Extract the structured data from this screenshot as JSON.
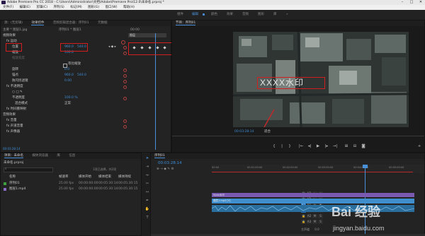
{
  "app": {
    "title_bar": "Adobe Premiere Pro CC 2018 - C:\\Users\\Administrator\\文档\\Adobe\\Premiere Pro\\12.0\\未命名.prproj *",
    "window_buttons": [
      "–",
      "□",
      "✕"
    ]
  },
  "menu": [
    "文件(F)",
    "编辑(E)",
    "剪辑(C)",
    "序列(S)",
    "标记(M)",
    "图形(G)",
    "窗口(W)",
    "帮助(H)"
  ],
  "workspaces": [
    "组件",
    "编辑",
    "颜色",
    "效果",
    "音频",
    "图形",
    "库"
  ],
  "effect_controls": {
    "tabs": [
      "源：(无剪辑)",
      "效果控件",
      "音频剪辑混合器：序列01",
      "元数据"
    ],
    "source_row": "主要 * 图层1.jpg",
    "seq_row": "序列01 * 图层1",
    "timecode_left": "00:00",
    "clip_label": "图层",
    "section_video": "视频效果",
    "motion": "fx 运动",
    "params": [
      {
        "name": "位置",
        "v1": "960.0",
        "v2": "540.0"
      },
      {
        "name": "缩放",
        "v1": "100.0",
        "v2": ""
      },
      {
        "name": "缩放宽度",
        "v1": "",
        "v2": ""
      },
      {
        "name": "",
        "v1": "",
        "v2": ""
      },
      {
        "name": "旋转",
        "v1": "0.0",
        "v2": ""
      },
      {
        "name": "锚点",
        "v1": "960.0",
        "v2": "540.0"
      },
      {
        "name": "防闪烁滤镜",
        "v1": "0.00",
        "v2": ""
      }
    ],
    "uniform_scale": "等比缩放",
    "opacity": "fx 不透明度",
    "opacity_value": "100.0 %",
    "blend_label": "混合模式",
    "blend_value": "正常",
    "time_remap": "fx 时间重映射",
    "audio_section": "音频效果",
    "volume": "fx 音量",
    "channel_volume": "fx 声道音量",
    "panner": "fx 声像器",
    "timecode_bottom": "00:03:28:14"
  },
  "program_monitor": {
    "tab": "节目：序列01",
    "timecode": "00:03:28:14",
    "fit": "适合",
    "watermark_text": "XXXX水印",
    "transport": [
      "{",
      "|",
      "}",
      "|←",
      "◂|",
      "▶",
      "|▸",
      "→|",
      "⊞",
      "⊟",
      "📷"
    ]
  },
  "project": {
    "tabs": [
      "项目：未命名",
      "媒体浏览器",
      "库",
      "信息"
    ],
    "path": "未命名.prproj",
    "count": "1项已选择，共2项",
    "columns": [
      "名称",
      "帧速率",
      "媒体开始",
      "媒体结束",
      "媒体持续"
    ],
    "rows": [
      {
        "name": "序列01",
        "fps": "25.00 fps",
        "start": "00:00:00:00",
        "end": "00:05:30:14",
        "dur": "00:05:30:15",
        "color": "#3fa03f"
      },
      {
        "name": "图层1.mp4",
        "fps": "25.00 fps",
        "start": "00:00:00:00",
        "end": "00:05:30:14",
        "dur": "00:05:30:15",
        "color": "#8a6cc7"
      }
    ]
  },
  "timeline": {
    "tab": "序列01",
    "timecode": "00:03:28:14",
    "ruler": [
      "00:00",
      "00:01:00:00",
      "00:02:00:00",
      "00:03:00:00",
      "00:04:00:00",
      "00:05:00:00"
    ],
    "tracks": [
      "V3",
      "V2",
      "V1",
      "A1",
      "A2",
      "A3"
    ],
    "master": "主声道",
    "master_val": "0.0",
    "clips": {
      "text": "Xxxx水印",
      "video": "图层1.mp4 [V]"
    }
  },
  "brand": {
    "name": "Bai 经验",
    "url": "jingyan.baidu.com"
  }
}
